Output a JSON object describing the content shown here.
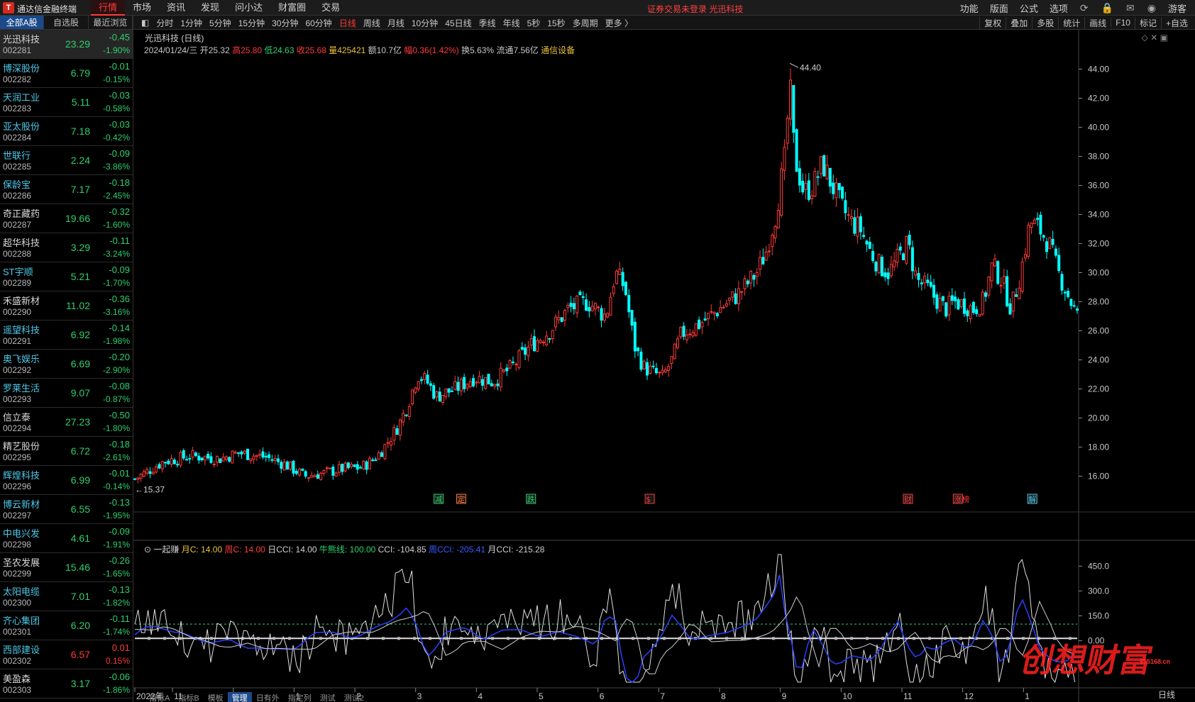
{
  "app": {
    "logo": "T",
    "title": "通达信金融终端"
  },
  "menu": [
    "行情",
    "市场",
    "资讯",
    "发现",
    "问小达",
    "财富圈",
    "交易"
  ],
  "notice": "证券交易未登录 光迅科技",
  "right_menu": [
    "功能",
    "版面",
    "公式",
    "选项"
  ],
  "guest": "游客",
  "sidebar_tabs": [
    "全部A股",
    "自选股",
    "最近浏览"
  ],
  "stocks": [
    {
      "name": "光迅科技",
      "code": "002281",
      "price": "23.29",
      "chg": "-0.45",
      "pct": "-1.90%"
    },
    {
      "name": "博深股份",
      "code": "002282",
      "price": "6.79",
      "chg": "-0.01",
      "pct": "-0.15%"
    },
    {
      "name": "天润工业",
      "code": "002283",
      "price": "5.11",
      "chg": "-0.03",
      "pct": "-0.58%"
    },
    {
      "name": "亚太股份",
      "code": "002284",
      "price": "7.18",
      "chg": "-0.03",
      "pct": "-0.42%"
    },
    {
      "name": "世联行",
      "code": "002285",
      "price": "2.24",
      "chg": "-0.09",
      "pct": "-3.86%"
    },
    {
      "name": "保龄宝",
      "code": "002286",
      "price": "7.17",
      "chg": "-0.18",
      "pct": "-2.45%"
    },
    {
      "name": "奇正藏药",
      "code": "002287",
      "price": "19.66",
      "chg": "-0.32",
      "pct": "-1.60%"
    },
    {
      "name": "超华科技",
      "code": "002288",
      "price": "3.29",
      "chg": "-0.11",
      "pct": "-3.24%"
    },
    {
      "name": "ST宇顺",
      "code": "002289",
      "price": "5.21",
      "chg": "-0.09",
      "pct": "-1.70%"
    },
    {
      "name": "禾盛新材",
      "code": "002290",
      "price": "11.02",
      "chg": "-0.36",
      "pct": "-3.16%"
    },
    {
      "name": "遥望科技",
      "code": "002291",
      "price": "6.92",
      "chg": "-0.14",
      "pct": "-1.98%"
    },
    {
      "name": "奥飞娱乐",
      "code": "002292",
      "price": "6.69",
      "chg": "-0.20",
      "pct": "-2.90%"
    },
    {
      "name": "罗莱生活",
      "code": "002293",
      "price": "9.07",
      "chg": "-0.08",
      "pct": "-0.87%"
    },
    {
      "name": "信立泰",
      "code": "002294",
      "price": "27.23",
      "chg": "-0.50",
      "pct": "-1.80%"
    },
    {
      "name": "精艺股份",
      "code": "002295",
      "price": "6.72",
      "chg": "-0.18",
      "pct": "-2.61%"
    },
    {
      "name": "辉煌科技",
      "code": "002296",
      "price": "6.99",
      "chg": "-0.01",
      "pct": "-0.14%"
    },
    {
      "name": "博云新材",
      "code": "002297",
      "price": "6.55",
      "chg": "-0.13",
      "pct": "-1.95%"
    },
    {
      "name": "中电兴发",
      "code": "002298",
      "price": "4.61",
      "chg": "-0.09",
      "pct": "-1.91%"
    },
    {
      "name": "圣农发展",
      "code": "002299",
      "price": "15.46",
      "chg": "-0.26",
      "pct": "-1.65%"
    },
    {
      "name": "太阳电缆",
      "code": "002300",
      "price": "7.01",
      "chg": "-0.13",
      "pct": "-1.82%"
    },
    {
      "name": "齐心集团",
      "code": "002301",
      "price": "6.20",
      "chg": "-0.11",
      "pct": "-1.74%"
    },
    {
      "name": "西部建设",
      "code": "002302",
      "price": "6.57",
      "chg": "0.01",
      "pct": "0.15%",
      "up": true
    },
    {
      "name": "美盈森",
      "code": "002303",
      "price": "3.17",
      "chg": "-0.06",
      "pct": "-1.86%"
    }
  ],
  "periods": [
    "分时",
    "1分钟",
    "5分钟",
    "15分钟",
    "30分钟",
    "60分钟",
    "日线",
    "周线",
    "月线",
    "10分钟",
    "45日线",
    "季线",
    "年线",
    "5秒",
    "15秒",
    "多周期",
    "更多 〉"
  ],
  "period_active": "日线",
  "period_right": [
    "复权",
    "叠加",
    "多股",
    "统计",
    "画线",
    "F10",
    "标记",
    "+自选"
  ],
  "chart_title": "光迅科技 (日线)",
  "info": {
    "date": "2024/01/24/三",
    "open": "开25.32",
    "high": "高25.80",
    "low": "低24.63",
    "close": "收25.68",
    "vol": "量425421",
    "amt": "额10.7亿",
    "amp": "幅0.36(1.42%)",
    "turn": "换5.63%",
    "float": "流通7.56亿",
    "sector": "通信设备"
  },
  "indicator": {
    "name": "一起赚",
    "month_c": "月C: 14.00",
    "week_c": "周C: 14.00",
    "day_cci": "日CCI: 14.00",
    "bull": "牛熊线: 100.00",
    "cci": "CCI: -104.85",
    "week_cci": "周CCI: -205.41",
    "month_cci": "月CCI: -215.28"
  },
  "bottom_tabs": [
    "指标A",
    "指标B",
    "模板",
    "管理",
    "日有外",
    "指定列",
    "测试",
    "测试2"
  ],
  "day_btn": "日线",
  "watermark": "创想财富",
  "watermark_sub": "995168.cn",
  "colors": {
    "up": "#ff3a3a",
    "down": "#00ffff",
    "bg": "#000000",
    "grid": "#2a2a2a"
  },
  "chart_data": {
    "type": "candlestick",
    "title": "光迅科技 (日线)",
    "y_ticks": [
      "44.00",
      "42.00",
      "40.00",
      "38.00",
      "36.00",
      "34.00",
      "32.00",
      "30.00",
      "28.00",
      "26.00",
      "24.00",
      "22.00",
      "20.00",
      "18.00",
      "16.00"
    ],
    "ylim": [
      15,
      45
    ],
    "x_ticks": [
      "2022年",
      "11",
      "12",
      "1",
      "2",
      "3",
      "4",
      "5",
      "6",
      "7",
      "8",
      "9",
      "10",
      "11",
      "12",
      "1"
    ],
    "max_label": "44.40",
    "min_label": "15.37",
    "events": [
      {
        "label": "减",
        "color": "#2ed06e",
        "pos": 0.322
      },
      {
        "label": "定",
        "color": "#ff7030",
        "pos": 0.346
      },
      {
        "label": "跌",
        "color": "#2ed06e",
        "pos": 0.42
      },
      {
        "label": "$",
        "color": "#ff3a3a",
        "pos": 0.546
      },
      {
        "label": "财",
        "color": "#ff3a3a",
        "pos": 0.82
      },
      {
        "label": "涨榜",
        "color": "#ff3a3a",
        "pos": 0.873
      },
      {
        "label": "解",
        "color": "#4ec9e8",
        "pos": 0.952
      }
    ],
    "ind_ticks": [
      "450.0",
      "300.0",
      "150.0",
      "0.00"
    ],
    "ind_ylim": [
      -250,
      520
    ],
    "close_path": [
      [
        0,
        15.8
      ],
      [
        0.03,
        17.0
      ],
      [
        0.06,
        17.4
      ],
      [
        0.09,
        17.2
      ],
      [
        0.11,
        17.6
      ],
      [
        0.14,
        17.3
      ],
      [
        0.16,
        16.8
      ],
      [
        0.18,
        16.0
      ],
      [
        0.2,
        16.2
      ],
      [
        0.22,
        16.5
      ],
      [
        0.24,
        16.6
      ],
      [
        0.25,
        17.0
      ],
      [
        0.26,
        17.6
      ],
      [
        0.27,
        18.5
      ],
      [
        0.28,
        19.5
      ],
      [
        0.29,
        21.0
      ],
      [
        0.3,
        23.0
      ],
      [
        0.31,
        22.5
      ],
      [
        0.32,
        21.5
      ],
      [
        0.34,
        22.0
      ],
      [
        0.36,
        22.8
      ],
      [
        0.38,
        22.5
      ],
      [
        0.4,
        23.5
      ],
      [
        0.42,
        25.0
      ],
      [
        0.44,
        26.0
      ],
      [
        0.46,
        27.5
      ],
      [
        0.48,
        28.0
      ],
      [
        0.5,
        27.0
      ],
      [
        0.51,
        30.0
      ],
      [
        0.52,
        29.0
      ],
      [
        0.53,
        25.0
      ],
      [
        0.54,
        23.5
      ],
      [
        0.56,
        22.8
      ],
      [
        0.57,
        24.0
      ],
      [
        0.58,
        25.8
      ],
      [
        0.6,
        26.5
      ],
      [
        0.62,
        27.5
      ],
      [
        0.64,
        28.5
      ],
      [
        0.66,
        30.0
      ],
      [
        0.67,
        31.5
      ],
      [
        0.68,
        34.0
      ],
      [
        0.69,
        38.0
      ],
      [
        0.695,
        43.0
      ],
      [
        0.7,
        38.0
      ],
      [
        0.71,
        35.5
      ],
      [
        0.72,
        36.0
      ],
      [
        0.73,
        37.5
      ],
      [
        0.74,
        36.0
      ],
      [
        0.75,
        34.5
      ],
      [
        0.76,
        33.5
      ],
      [
        0.77,
        33.0
      ],
      [
        0.78,
        31.5
      ],
      [
        0.79,
        30.5
      ],
      [
        0.8,
        30.0
      ],
      [
        0.81,
        31.0
      ],
      [
        0.82,
        32.0
      ],
      [
        0.83,
        29.5
      ],
      [
        0.84,
        29.0
      ],
      [
        0.85,
        28.2
      ],
      [
        0.86,
        27.5
      ],
      [
        0.87,
        28.0
      ],
      [
        0.88,
        27.8
      ],
      [
        0.89,
        27.5
      ],
      [
        0.9,
        28.0
      ],
      [
        0.91,
        30.5
      ],
      [
        0.92,
        29.5
      ],
      [
        0.93,
        27.5
      ],
      [
        0.94,
        30.0
      ],
      [
        0.95,
        33.5
      ],
      [
        0.96,
        33.0
      ],
      [
        0.97,
        32.0
      ],
      [
        0.98,
        30.0
      ],
      [
        0.99,
        28.5
      ],
      [
        1.0,
        27.0
      ]
    ]
  }
}
